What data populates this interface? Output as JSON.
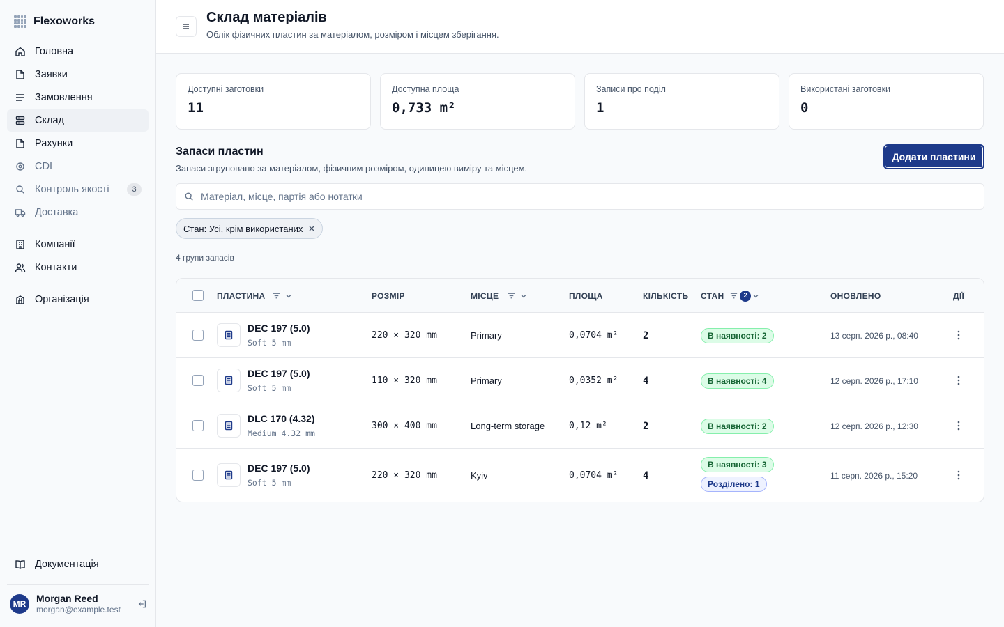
{
  "app": {
    "name": "Flexoworks"
  },
  "sidebar": {
    "items": [
      {
        "label": "Головна",
        "icon": "home-icon"
      },
      {
        "label": "Заявки",
        "icon": "file-icon"
      },
      {
        "label": "Замовлення",
        "icon": "list-icon"
      },
      {
        "label": "Склад",
        "icon": "warehouse-icon",
        "active": true
      },
      {
        "label": "Рахунки",
        "icon": "file-icon"
      },
      {
        "label": "CDI",
        "icon": "target-icon",
        "muted": true
      },
      {
        "label": "Контроль якості",
        "icon": "search-icon",
        "muted": true,
        "badge": "3"
      },
      {
        "label": "Доставка",
        "icon": "truck-icon",
        "muted": true
      }
    ],
    "secondary": [
      {
        "label": "Компанії",
        "icon": "building-icon"
      },
      {
        "label": "Контакти",
        "icon": "users-icon"
      }
    ],
    "org": {
      "label": "Організація",
      "icon": "org-icon"
    },
    "docs": {
      "label": "Документація",
      "icon": "book-icon"
    },
    "user": {
      "initials": "MR",
      "name": "Morgan Reed",
      "email": "morgan@example.test"
    }
  },
  "header": {
    "title": "Склад матеріалів",
    "subtitle": "Облік фізичних пластин за матеріалом, розміром і місцем зберігання."
  },
  "stats": [
    {
      "label": "Доступні заготовки",
      "value": "11"
    },
    {
      "label": "Доступна площа",
      "value": "0,733 m²"
    },
    {
      "label": "Записи про поділ",
      "value": "1"
    },
    {
      "label": "Використані заготовки",
      "value": "0"
    }
  ],
  "section": {
    "title": "Запаси пластин",
    "subtitle": "Запаси згруповано за матеріалом, фізичним розміром, одиницею виміру та місцем.",
    "add_button": "Додати пластини"
  },
  "search": {
    "placeholder": "Матеріал, місце, партія або нотатки",
    "value": ""
  },
  "filter_chip": {
    "label": "Стан: Усі, крім використаних"
  },
  "group_count": "4 групи запасів",
  "table": {
    "headers": {
      "plate": "Пластина",
      "size": "Розмір",
      "location": "Місце",
      "area": "Площа",
      "qty": "Кількість",
      "state": "Стан",
      "state_filter_count": "2",
      "updated": "Оновлено",
      "actions": "Дії"
    },
    "rows": [
      {
        "name": "DEC 197 (5.0)",
        "sub": "Soft 5 mm",
        "size": "220 × 320 mm",
        "location": "Primary",
        "area": "0,0704 m²",
        "qty": "2",
        "badges": [
          {
            "kind": "green",
            "text": "В наявності: 2"
          }
        ],
        "updated": "13 серп. 2026 р., 08:40"
      },
      {
        "name": "DEC 197 (5.0)",
        "sub": "Soft 5 mm",
        "size": "110 × 320 mm",
        "location": "Primary",
        "area": "0,0352 m²",
        "qty": "4",
        "badges": [
          {
            "kind": "green",
            "text": "В наявності: 4"
          }
        ],
        "updated": "12 серп. 2026 р., 17:10"
      },
      {
        "name": "DLC 170 (4.32)",
        "sub": "Medium 4.32 mm",
        "size": "300 × 400 mm",
        "location": "Long-term storage",
        "area": "0,12 m²",
        "qty": "2",
        "badges": [
          {
            "kind": "green",
            "text": "В наявності: 2"
          }
        ],
        "updated": "12 серп. 2026 р., 12:30"
      },
      {
        "name": "DEC 197 (5.0)",
        "sub": "Soft 5 mm",
        "size": "220 × 320 mm",
        "location": "Kyiv",
        "area": "0,0704 m²",
        "qty": "4",
        "badges": [
          {
            "kind": "green",
            "text": "В наявності: 3"
          },
          {
            "kind": "blue",
            "text": "Розділено: 1"
          }
        ],
        "updated": "11 серп. 2026 р., 15:20"
      }
    ]
  },
  "colors": {
    "accent": "#1e3a8a",
    "success_bg": "#dcfce7",
    "success_text": "#166534"
  }
}
